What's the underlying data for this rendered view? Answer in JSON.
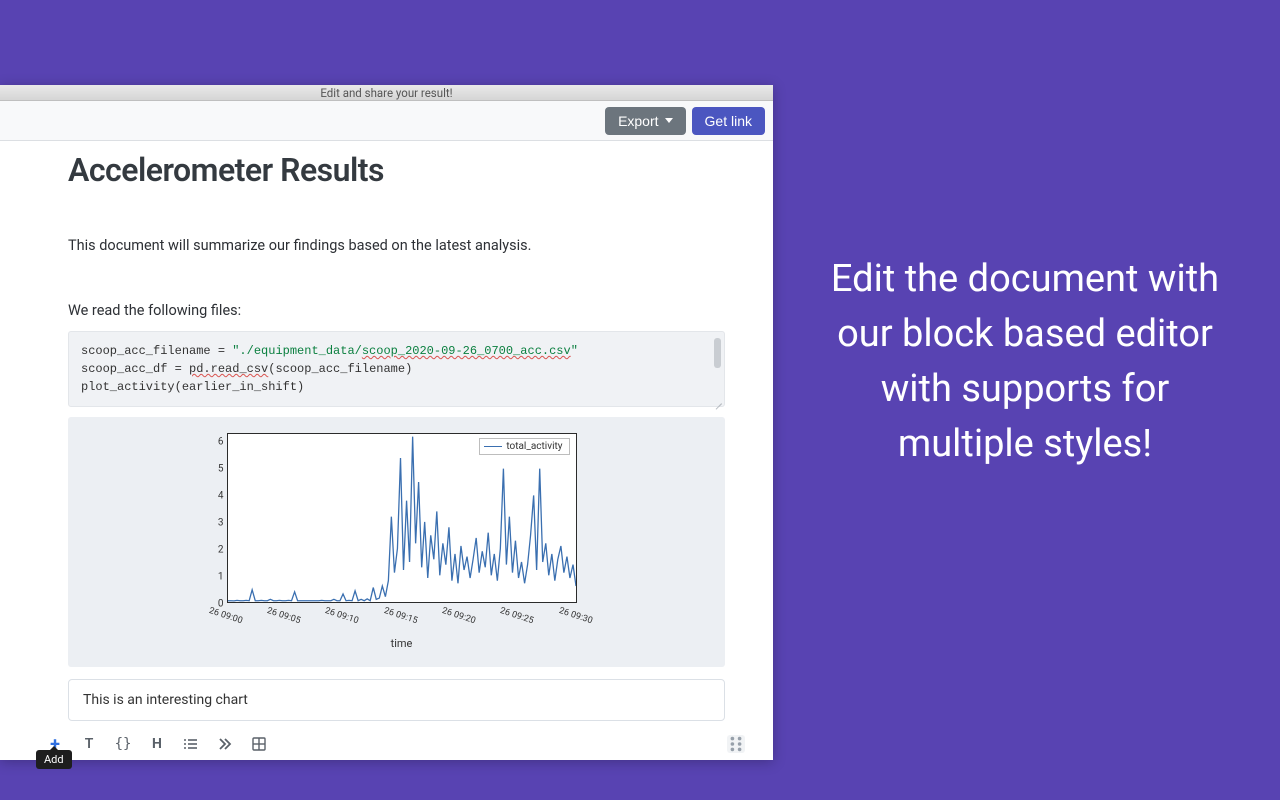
{
  "window": {
    "title": "Edit and share your result!"
  },
  "toolbar": {
    "export_label": "Export",
    "getlink_label": "Get link"
  },
  "document": {
    "heading": "Accelerometer Results",
    "summary": "This document will summarize our findings based on the latest analysis.",
    "files_intro": "We read the following files:",
    "code_plain": "scoop_acc_filename = \"./equipment_data/scoop_2020-09-26_0700_acc.csv\"\nscoop_acc_df = pd.read_csv(scoop_acc_filename)\nplot_activity(earlier_in_shift)",
    "code": {
      "line1_a": "scoop_acc_filename = ",
      "line1_str_a": "\"./equipment_data/",
      "line1_str_b": "scoop_2020-09-26_0700_acc.csv",
      "line1_str_c": "\"",
      "line2_a": "scoop_acc_df = ",
      "line2_b": "pd.read_csv",
      "line2_c": "(scoop_acc_filename)",
      "line3": "plot_activity(earlier_in_shift)"
    },
    "caption_input": "This is an interesting chart"
  },
  "block_toolbar": {
    "add_tooltip": "Add"
  },
  "chart_data": {
    "type": "line",
    "title": "",
    "xlabel": "time",
    "ylabel": "",
    "ylim": [
      0,
      6.3
    ],
    "x_categories": [
      "26 09:00",
      "26 09:05",
      "26 09:10",
      "26 09:15",
      "26 09:20",
      "26 09:25",
      "26 09:30"
    ],
    "series": [
      {
        "name": "total_activity",
        "color": "#3a6fb0",
        "values": [
          0.05,
          0.05,
          0.04,
          0.06,
          0.05,
          0.05,
          0.06,
          0.05,
          0.46,
          0.05,
          0.05,
          0.06,
          0.05,
          0.05,
          0.1,
          0.05,
          0.05,
          0.06,
          0.05,
          0.05,
          0.06,
          0.05,
          0.38,
          0.05,
          0.05,
          0.05,
          0.05,
          0.05,
          0.05,
          0.05,
          0.05,
          0.06,
          0.05,
          0.05,
          0.05,
          0.1,
          0.05,
          0.05,
          0.3,
          0.05,
          0.06,
          0.05,
          0.42,
          0.05,
          0.1,
          0.05,
          0.12,
          0.05,
          0.54,
          0.1,
          0.15,
          0.6,
          0.2,
          0.8,
          3.2,
          1.1,
          2.0,
          5.4,
          1.2,
          3.8,
          1.5,
          6.2,
          2.2,
          4.5,
          1.3,
          3.0,
          0.9,
          2.5,
          1.6,
          3.4,
          1.0,
          2.2,
          1.4,
          2.8,
          0.8,
          1.8,
          0.7,
          2.1,
          1.2,
          1.7,
          0.9,
          1.6,
          2.4,
          1.1,
          1.9,
          1.3,
          2.6,
          1.0,
          1.8,
          0.8,
          2.0,
          5.0,
          1.4,
          3.2,
          1.1,
          2.3,
          0.9,
          1.5,
          0.7,
          1.4,
          2.5,
          4.0,
          1.2,
          5.0,
          1.5,
          2.2,
          1.0,
          1.8,
          0.8,
          1.6,
          2.1,
          1.1,
          1.7,
          0.9,
          1.4,
          0.6
        ]
      }
    ]
  },
  "promo": {
    "text": "Edit the document with our block based editor with supports for multiple styles!"
  }
}
